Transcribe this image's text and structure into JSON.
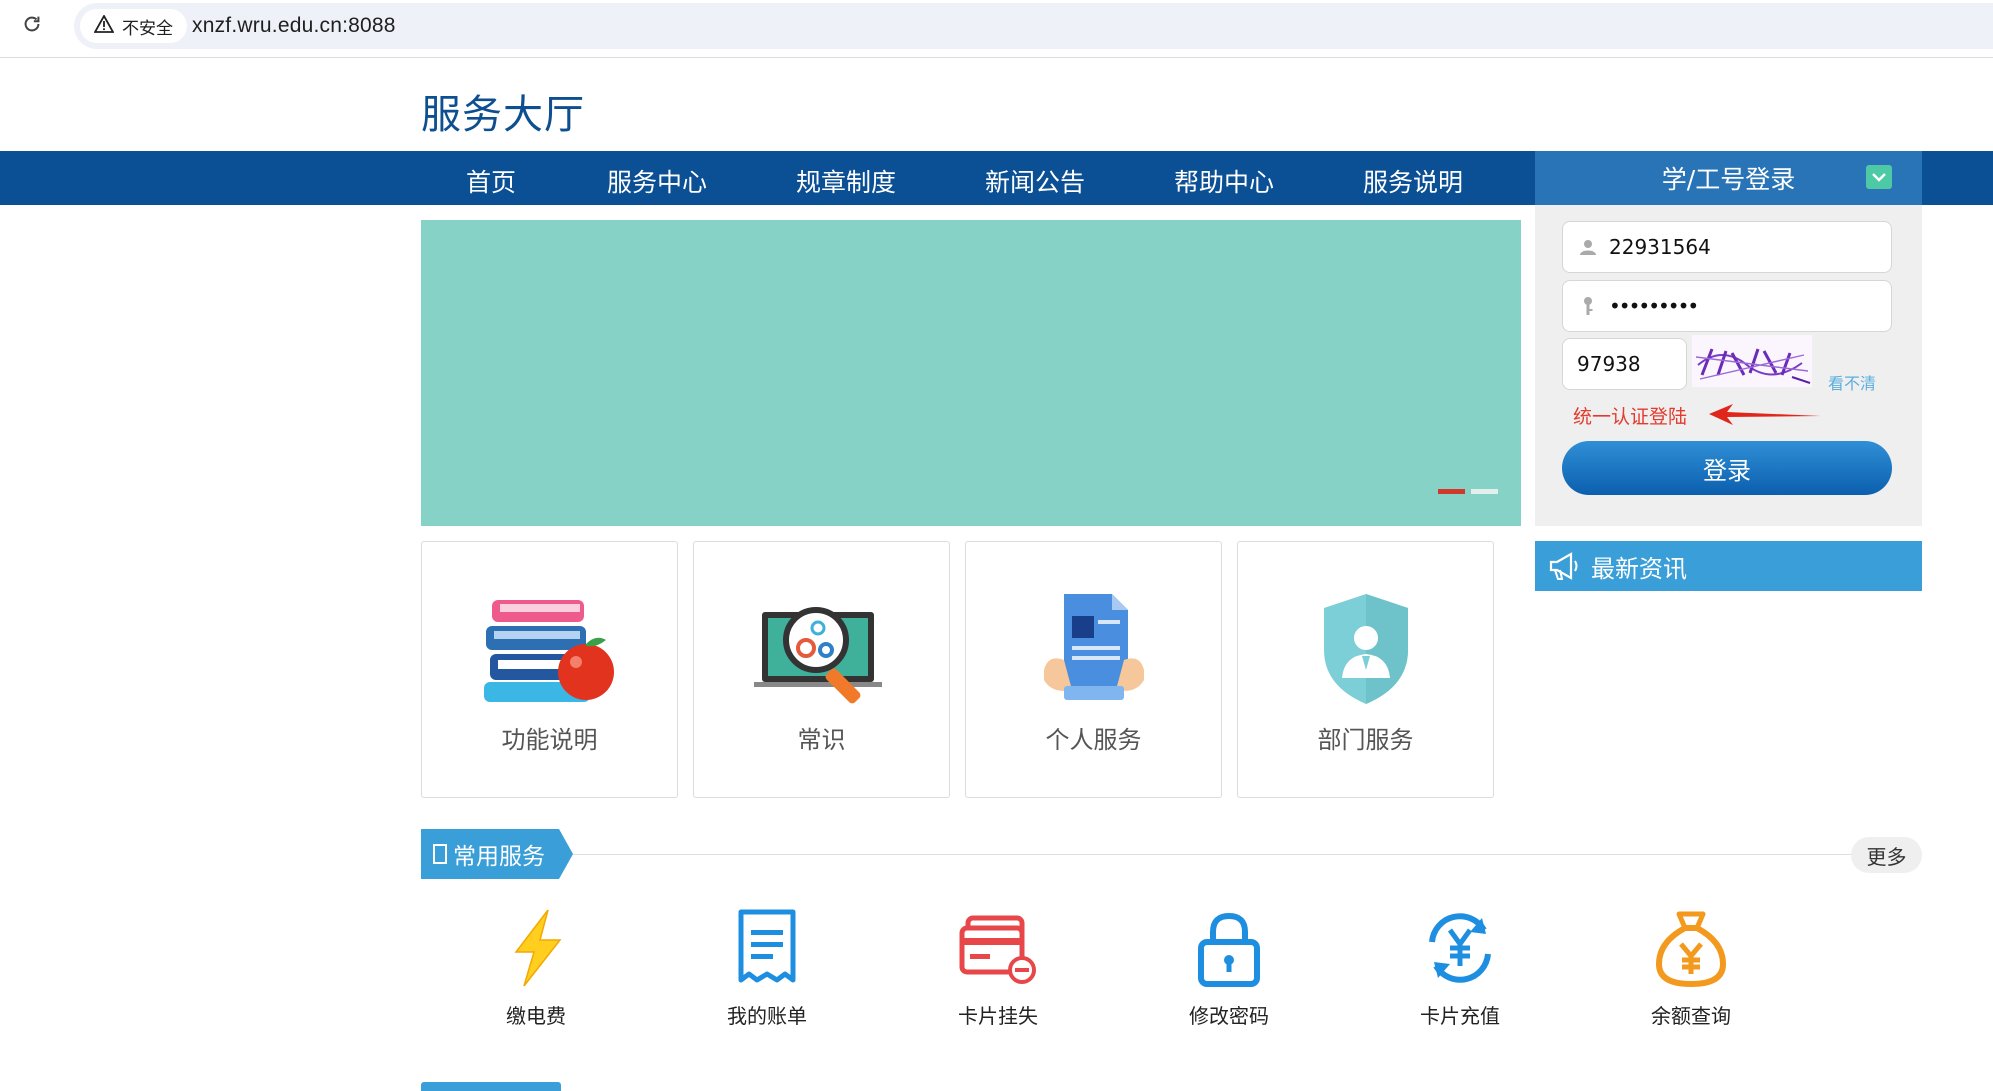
{
  "browser": {
    "security_label": "不安全",
    "url": "xnzf.wru.edu.cn:8088"
  },
  "site": {
    "title": "服务大厅"
  },
  "nav": {
    "items": [
      {
        "label": "首页"
      },
      {
        "label": "服务中心"
      },
      {
        "label": "规章制度"
      },
      {
        "label": "新闻公告"
      },
      {
        "label": "帮助中心"
      },
      {
        "label": "服务说明"
      }
    ]
  },
  "login": {
    "header": "学/工号登录",
    "username_value": "22931564",
    "password_value": "•••••••••",
    "captcha_value": "97938",
    "cant_see": "看不清",
    "unified_login": "统一认证登陆",
    "submit": "登录"
  },
  "news": {
    "header": "最新资讯"
  },
  "cards": [
    {
      "label": "功能说明"
    },
    {
      "label": "常识"
    },
    {
      "label": "个人服务"
    },
    {
      "label": "部门服务"
    }
  ],
  "common_services": {
    "header": "常用服务",
    "more": "更多",
    "items": [
      {
        "label": "缴电费",
        "icon": "lightning-icon"
      },
      {
        "label": "我的账单",
        "icon": "bill-icon"
      },
      {
        "label": "卡片挂失",
        "icon": "card-lost-icon"
      },
      {
        "label": "修改密码",
        "icon": "lock-icon"
      },
      {
        "label": "卡片充值",
        "icon": "yuan-refresh-icon"
      },
      {
        "label": "余额查询",
        "icon": "money-bag-icon"
      }
    ]
  },
  "colors": {
    "nav_bg": "#0b4f95",
    "login_head_bg": "#2874b6",
    "banner": "#87d2c6",
    "accent_blue": "#3a9ed8",
    "alert_red": "#e23b2e"
  }
}
